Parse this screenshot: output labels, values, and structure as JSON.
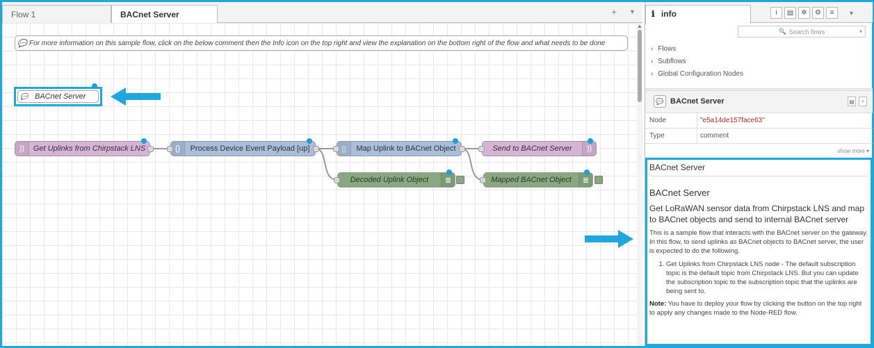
{
  "workspace": {
    "tabs": [
      {
        "label": "Flow 1"
      },
      {
        "label": "BACnet Server"
      }
    ],
    "add_tab_icon": "plus-icon",
    "tab_menu_icon": "caret-down-icon"
  },
  "canvas": {
    "top_comment": "For more information on this sample flow, click on the below comment then the Info icon on the top right and view the explanation on the bottom right of the flow and what needs to be done",
    "bacnet_comment": "BACnet Server",
    "nodes": {
      "get_uplinks": "Get Uplinks from Chirpstack LNS",
      "process_payload": "Process Device Event Payload [up]",
      "map_uplink": "Map Uplink to BACnet Object",
      "send_bacnet": "Send to BACnet Server",
      "decoded_uplink": "Decoded Uplink Object",
      "mapped_bacnet": "Mapped BACnet Object"
    },
    "colors": {
      "mqtt": "#d7b3d7",
      "function": "#a9bedb",
      "change": "#a9bedb",
      "debug": "#87a980",
      "highlight": "#1fa8df"
    }
  },
  "sidebar": {
    "tab_label": "info",
    "tab_icons": [
      "info-icon",
      "book-icon",
      "bug-icon",
      "gear-icon",
      "database-icon"
    ],
    "search_placeholder": "Search flows",
    "tree": [
      "Flows",
      "Subflows",
      "Global Configuration Nodes"
    ],
    "node_title": "BACnet Server",
    "props": [
      {
        "key": "Node",
        "value": "\"e5a14de157face63\""
      },
      {
        "key": "Type",
        "value": "comment"
      }
    ],
    "show_more": "show more ▾",
    "help": {
      "title": "BACnet Server",
      "heading": "BACnet Server",
      "subheading": "Get LoRaWAN sensor data from Chirpstack LNS and map to BACnet objects and send to internal BACnet server",
      "intro": "This is a sample flow that interacts with the BACnet server on the gateway. In this flow, to send uplinks as BACnet objects to BACnet server, the user is expected to do the following.",
      "steps": [
        "Get Uplinks from Chirpstack LNS node - The default subscription topic is the default topic from Chirpstack LNS. But you can update the subscription topic to the subscription topic that the uplinks are being sent to."
      ],
      "note_label": "Note:",
      "note_text": " You have to deploy your flow by clicking the button on the top right to apply any changes made to the Node-RED flow."
    }
  }
}
